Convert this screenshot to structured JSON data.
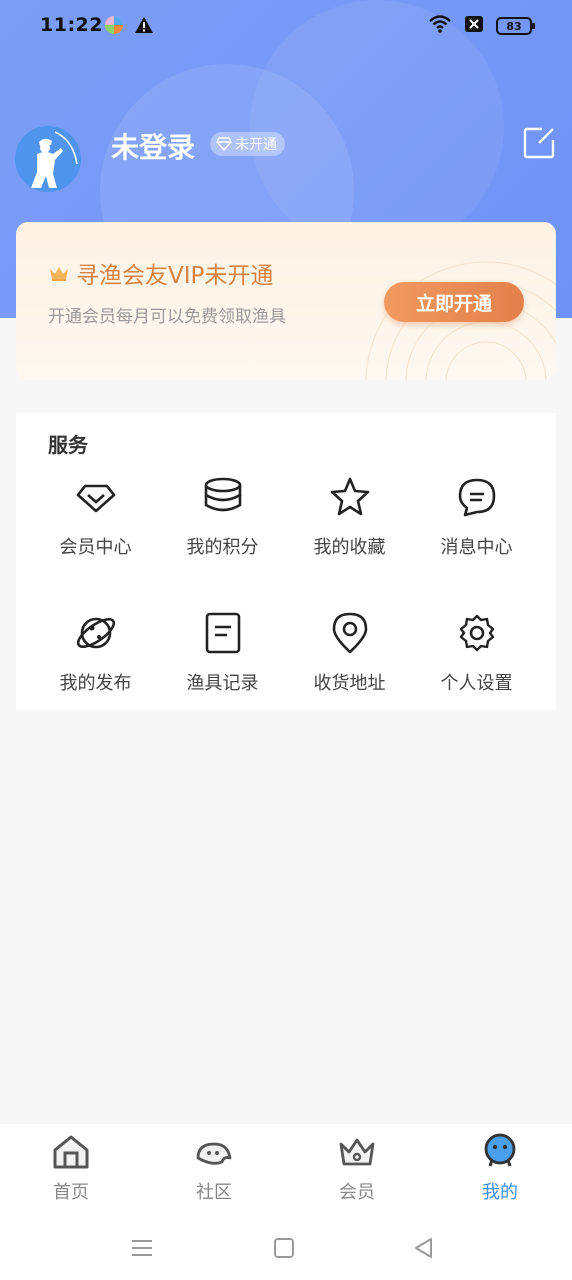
{
  "status_bar": {
    "time": "11:22",
    "battery": "83",
    "icons": [
      "app-icon",
      "alert-icon",
      "wifi-icon",
      "x-app-icon",
      "battery-icon"
    ]
  },
  "profile": {
    "name": "未登录",
    "vip_badge": "未开通"
  },
  "vip_card": {
    "title": "寻渔会友VIP未开通",
    "subtitle": "开通会员每月可以免费领取渔具",
    "button": "立即开通",
    "accent": "#e2804a"
  },
  "services": {
    "title": "服务",
    "items": [
      {
        "label": "会员中心",
        "icon": "diamond-icon"
      },
      {
        "label": "我的积分",
        "icon": "coins-icon"
      },
      {
        "label": "我的收藏",
        "icon": "star-icon"
      },
      {
        "label": "消息中心",
        "icon": "chat-icon"
      },
      {
        "label": "我的发布",
        "icon": "planet-icon"
      },
      {
        "label": "渔具记录",
        "icon": "document-icon"
      },
      {
        "label": "收货地址",
        "icon": "location-pin-icon"
      },
      {
        "label": "个人设置",
        "icon": "gear-icon"
      }
    ]
  },
  "tabbar": {
    "items": [
      {
        "label": "首页",
        "icon": "home-icon"
      },
      {
        "label": "社区",
        "icon": "community-icon"
      },
      {
        "label": "会员",
        "icon": "crown-icon"
      },
      {
        "label": "我的",
        "icon": "profile-face-icon",
        "active": true
      }
    ],
    "active_color": "#3f8fe6"
  }
}
